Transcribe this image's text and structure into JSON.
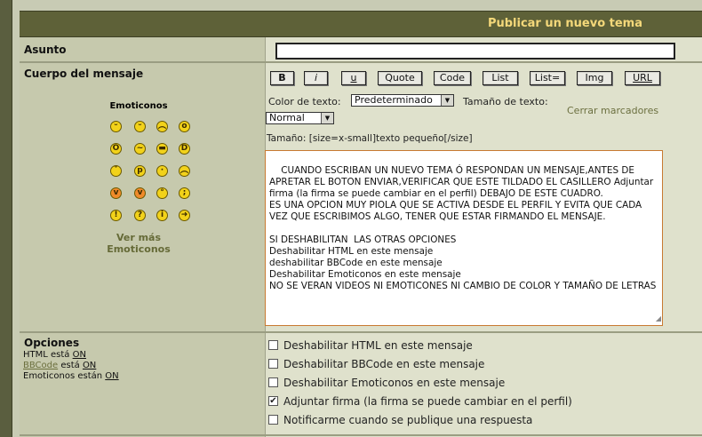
{
  "header": {
    "title": "Publicar un nuevo tema"
  },
  "subject": {
    "label": "Asunto",
    "value": ""
  },
  "body": {
    "label": "Cuerpo del mensaje",
    "emoticons_title": "Emoticonos",
    "more_emoticons": [
      "Ver más",
      "Emoticonos"
    ],
    "emoticons": [
      [
        "grin-icon",
        "smile-icon",
        "sad-icon",
        "surprised-icon"
      ],
      [
        "shocked-icon",
        "confused-icon",
        "cool-icon",
        "laugh-icon"
      ],
      [
        "mad-icon",
        "razz-icon",
        "embarrassed-icon",
        "cry-icon"
      ],
      [
        "evil-icon",
        "twisted-icon",
        "rolleyes-icon",
        "wink-icon"
      ],
      [
        "exclaim-icon",
        "question-icon",
        "idea-icon",
        "arrow-icon"
      ]
    ]
  },
  "toolbar": {
    "buttons": [
      "B",
      "i",
      "u",
      "Quote",
      "Code",
      "List",
      "List=",
      "Img",
      "URL"
    ],
    "color_label": "Color de texto:",
    "color_value": "Predeterminado",
    "size_label": "Tamaño de texto:",
    "size_value": "Normal",
    "close_tags": "Cerrar marcadores",
    "help_line": "Tamaño: [size=x-small]texto pequeño[/size]"
  },
  "message": {
    "text": "CUANDO ESCRIBAN UN NUEVO TEMA Ó RESPONDAN UN MENSAJE,ANTES DE APRETAR EL BOTON ENVIAR,VERIFICAR QUE ESTE TILDADO EL CASILLERO Adjuntar firma (la firma se puede cambiar en el perfil) DEBAJO DE ESTE CUADRO.\nES UNA OPCION MUY PIOLA QUE SE ACTIVA DESDE EL PERFIL Y EVITA QUE CADA VEZ QUE ESCRIBIMOS ALGO, TENER QUE ESTAR FIRMANDO EL MENSAJE.\n\nSI DESHABILITAN  LAS OTRAS OPCIONES\nDeshabilitar HTML en este mensaje\ndeshabilitar BBCode en este mensaje\nDeshabilitar Emoticonos en este mensaje\nNO SE VERAN VIDEOS NI EMOTICONES NI CAMBIO DE COLOR Y TAMAÑO DE LETRAS"
  },
  "options": {
    "label": "Opciones",
    "html_status": [
      "HTML está ",
      "ON"
    ],
    "bbcode_status": [
      "BBCode",
      " está ",
      "ON"
    ],
    "emoticons_status": [
      "Emoticonos están ",
      "ON"
    ],
    "checkboxes": [
      {
        "label": "Deshabilitar HTML en este mensaje",
        "checked": false
      },
      {
        "label": "Deshabilitar BBCode en este mensaje",
        "checked": false
      },
      {
        "label": "Deshabilitar Emoticonos en este mensaje",
        "checked": false
      },
      {
        "label": "Adjuntar firma (la firma se puede cambiar en el perfil)",
        "checked": true
      },
      {
        "label": "Notificarme cuando se publique una respuesta",
        "checked": false
      }
    ]
  }
}
